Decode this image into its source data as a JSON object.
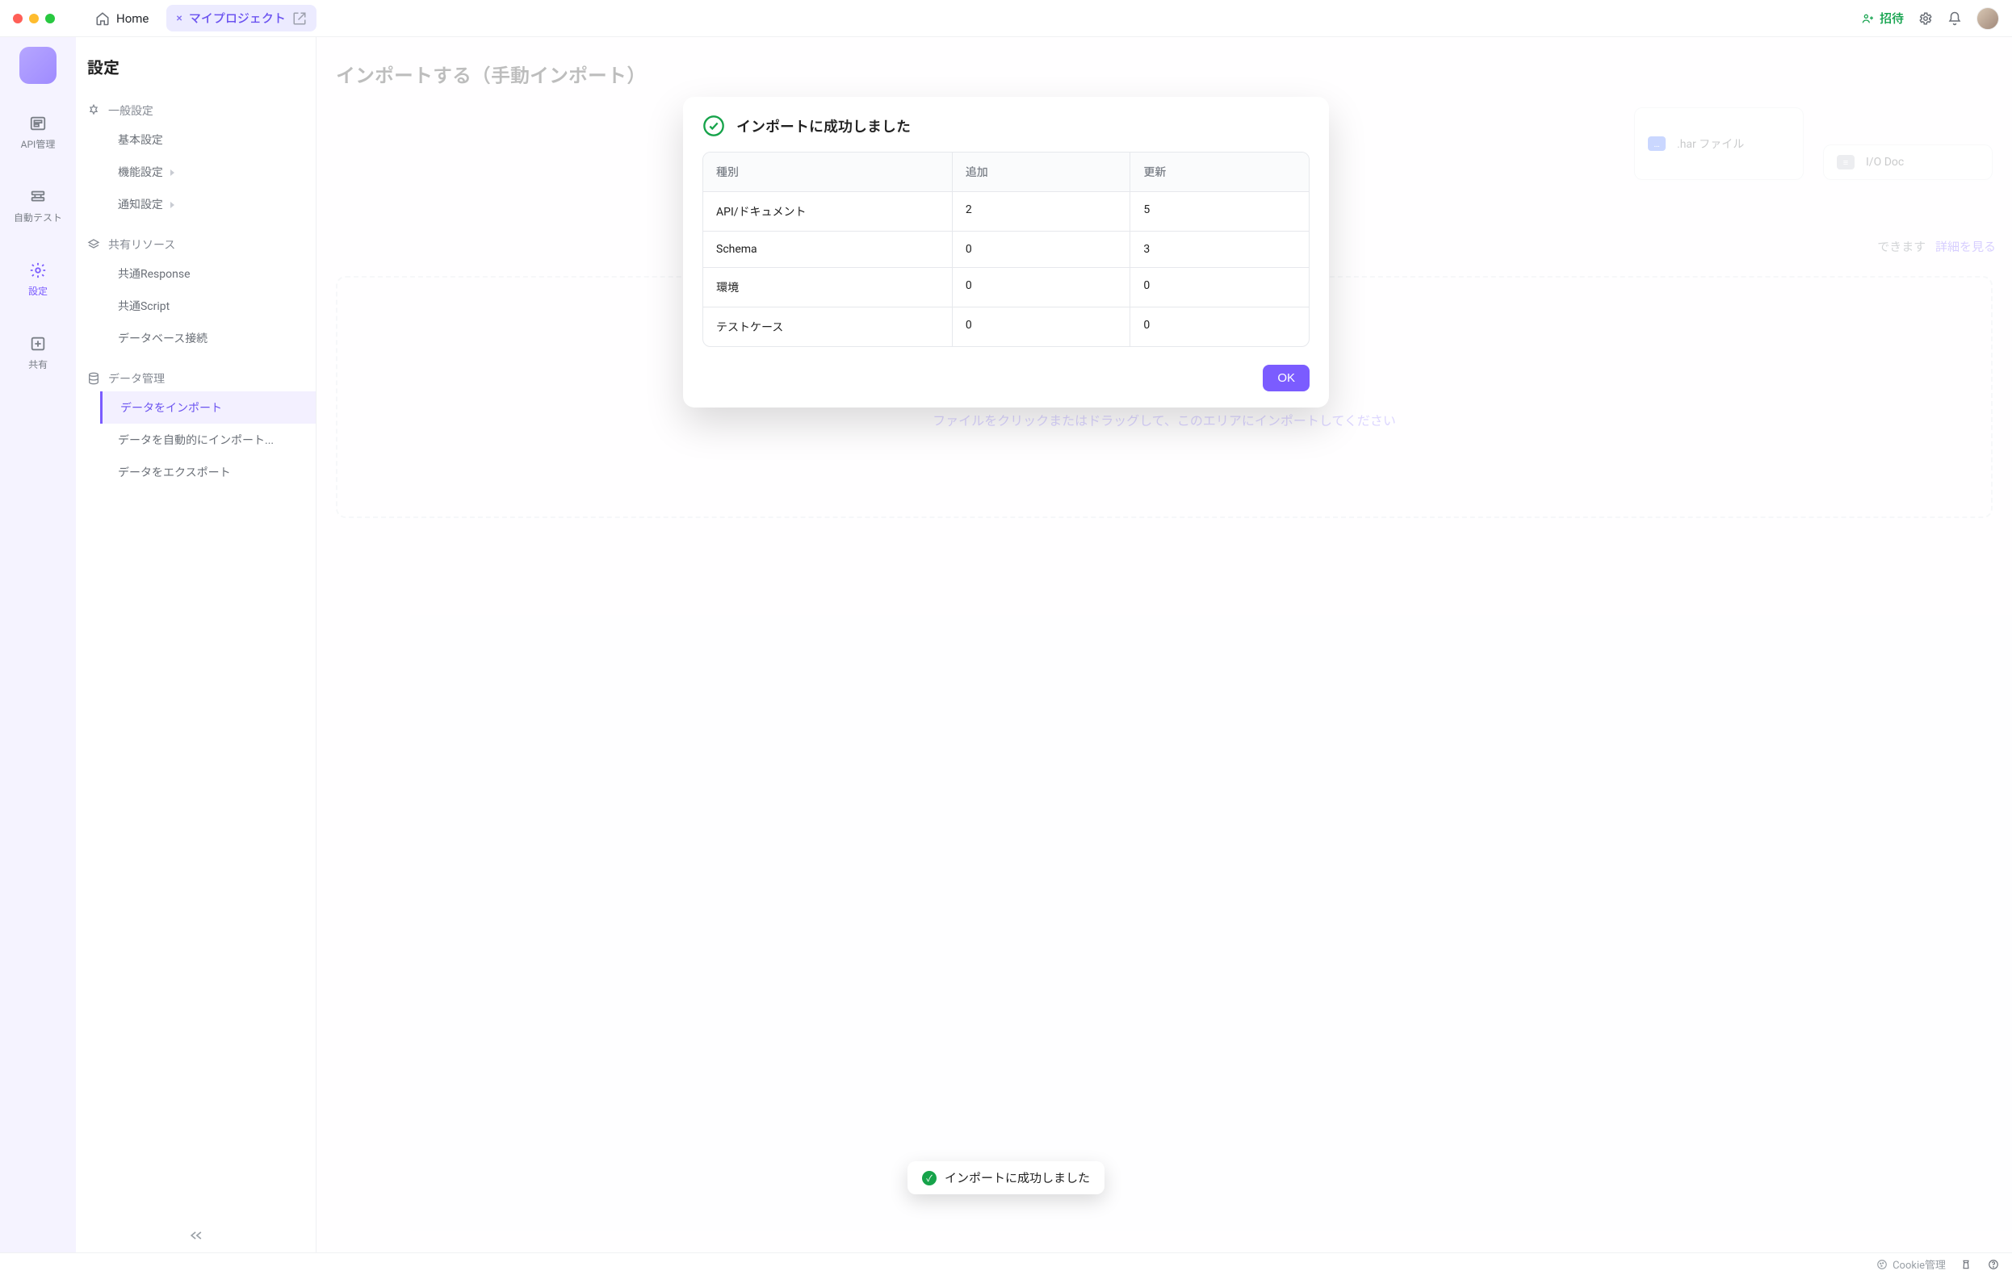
{
  "titlebar": {
    "home_label": "Home",
    "project_label": "マイプロジェクト",
    "invite_label": "招待"
  },
  "rail": {
    "api_label": "API管理",
    "test_label": "自動テスト",
    "settings_label": "設定",
    "share_label": "共有"
  },
  "sidebar": {
    "title": "設定",
    "groups": [
      {
        "head": "一般設定",
        "items": [
          {
            "label": "基本設定"
          },
          {
            "label": "機能設定"
          },
          {
            "label": "通知設定"
          }
        ]
      },
      {
        "head": "共有リソース",
        "items": [
          {
            "label": "共通Response"
          },
          {
            "label": "共通Script"
          },
          {
            "label": "データベース接続"
          }
        ]
      },
      {
        "head": "データ管理",
        "items": [
          {
            "label": "データをインポート"
          },
          {
            "label": "データを自動的にインポート..."
          },
          {
            "label": "データをエクスポート"
          }
        ]
      }
    ]
  },
  "page": {
    "title": "インポートする（手動インポート）",
    "cards": [
      {
        "label": ".har ファイル"
      },
      {
        "label": "I/O Doc"
      }
    ],
    "hint_text": "できます",
    "hint_link": "詳細を見る",
    "dropzone_text": "ファイルをクリックまたはドラッグして、このエリアにインポートしてください"
  },
  "modal": {
    "title": "インポートに成功しました",
    "headers": {
      "type": "種別",
      "added": "追加",
      "updated": "更新"
    },
    "rows": [
      {
        "type": "API/ドキュメント",
        "added": "2",
        "updated": "5"
      },
      {
        "type": "Schema",
        "added": "0",
        "updated": "3"
      },
      {
        "type": "環境",
        "added": "0",
        "updated": "0"
      },
      {
        "type": "テストケース",
        "added": "0",
        "updated": "0"
      }
    ],
    "ok_label": "OK"
  },
  "toast": {
    "text": "インポートに成功しました"
  },
  "statusbar": {
    "cookie_label": "Cookie管理"
  }
}
